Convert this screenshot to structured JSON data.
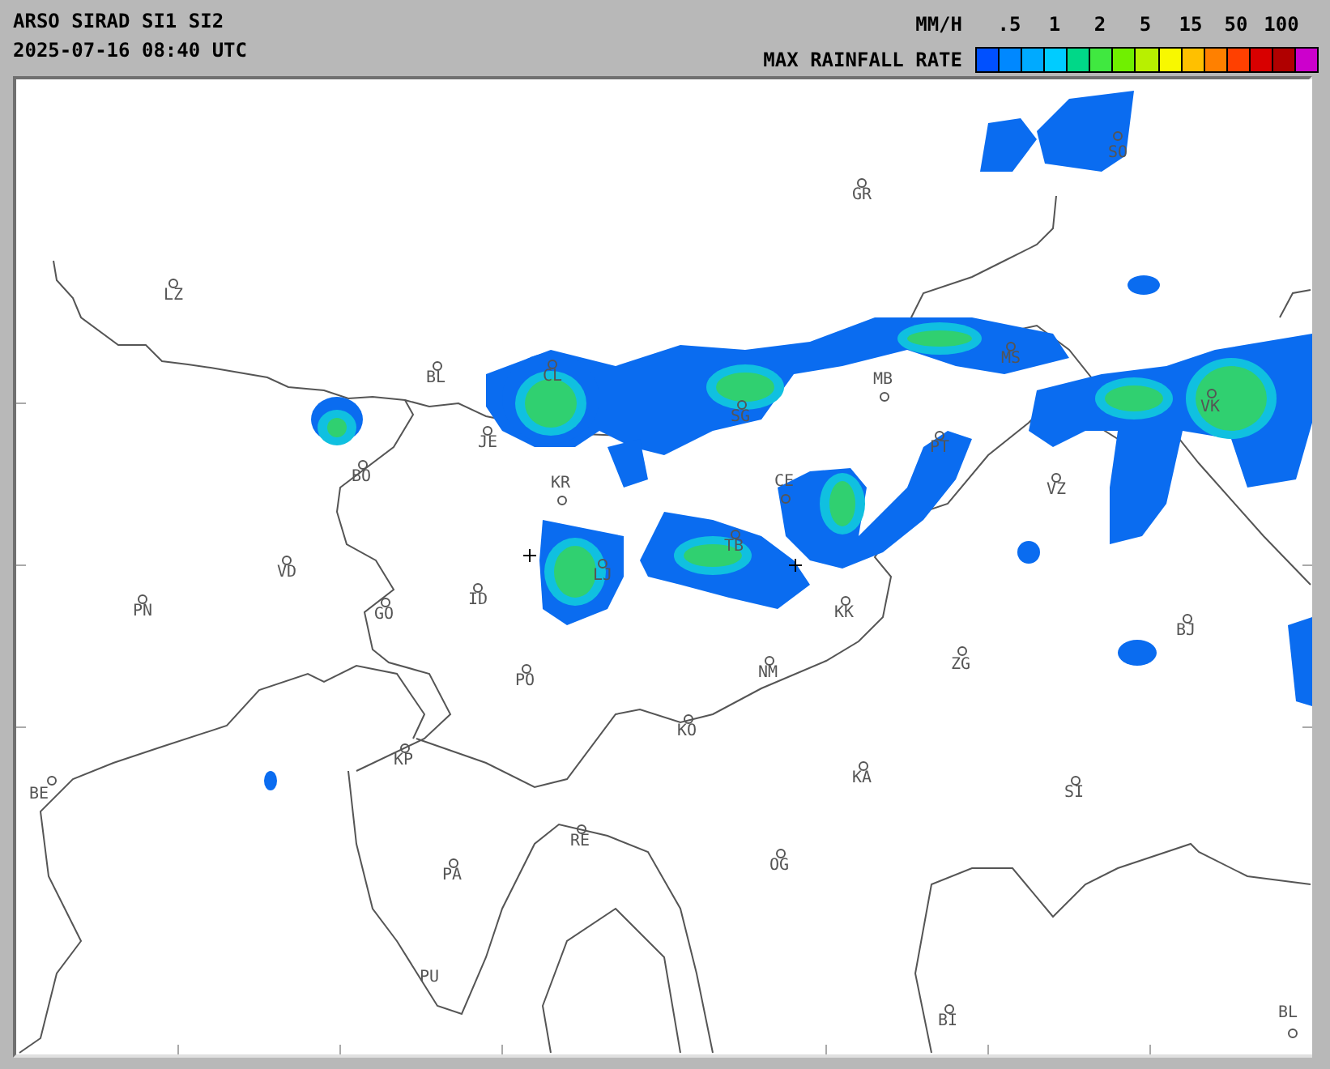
{
  "header": {
    "title": "ARSO SIRAD SI1 SI2",
    "timestamp": "2025-07-16 08:40 UTC"
  },
  "legend": {
    "unit": "MM/H",
    "title": "MAX RAINFALL RATE",
    "ticks": [
      ".5",
      "1",
      "2",
      "5",
      "15",
      "50",
      "100"
    ],
    "swatches": [
      {
        "color": "#0050ff"
      },
      {
        "color": "#0088ff"
      },
      {
        "color": "#00aaff"
      },
      {
        "color": "#00ccff"
      },
      {
        "color": "#00d888"
      },
      {
        "color": "#40e840"
      },
      {
        "color": "#70f000"
      },
      {
        "color": "#b8f000"
      },
      {
        "color": "#f8f800"
      },
      {
        "color": "#ffc000"
      },
      {
        "color": "#ff8000"
      },
      {
        "color": "#ff4000"
      },
      {
        "color": "#d80000"
      },
      {
        "color": "#b00000"
      },
      {
        "color": "#cc00cc"
      }
    ]
  },
  "cities": [
    {
      "name": "SO"
    },
    {
      "name": "GR"
    },
    {
      "name": "LZ"
    },
    {
      "name": "BL"
    },
    {
      "name": "CL"
    },
    {
      "name": "JE"
    },
    {
      "name": "BO"
    },
    {
      "name": "KR"
    },
    {
      "name": "LJ"
    },
    {
      "name": "VD"
    },
    {
      "name": "PN"
    },
    {
      "name": "GO"
    },
    {
      "name": "ID"
    },
    {
      "name": "SG"
    },
    {
      "name": "MB"
    },
    {
      "name": "MS"
    },
    {
      "name": "PT"
    },
    {
      "name": "CE"
    },
    {
      "name": "VZ"
    },
    {
      "name": "VK"
    },
    {
      "name": "TB"
    },
    {
      "name": "KK"
    },
    {
      "name": "BJ"
    },
    {
      "name": "ZG"
    },
    {
      "name": "NM"
    },
    {
      "name": "PO"
    },
    {
      "name": "KO"
    },
    {
      "name": "KP"
    },
    {
      "name": "KA"
    },
    {
      "name": "BE"
    },
    {
      "name": "SI"
    },
    {
      "name": "RE"
    },
    {
      "name": "PA"
    },
    {
      "name": "OG"
    },
    {
      "name": "PU"
    },
    {
      "name": "BI"
    },
    {
      "name": "BL"
    }
  ]
}
